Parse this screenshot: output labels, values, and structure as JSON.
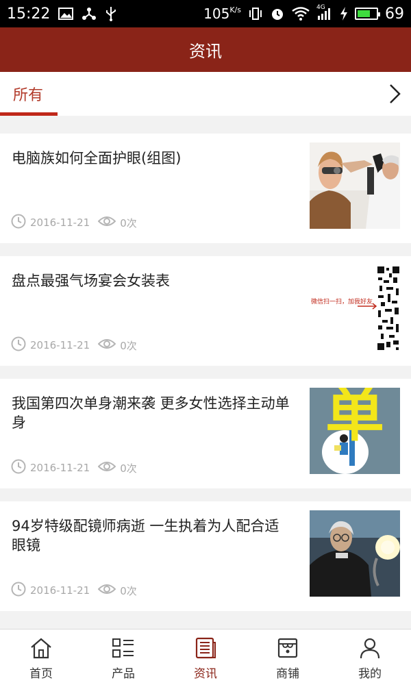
{
  "status_bar": {
    "time": "15:22",
    "speed": "105",
    "speed_unit": "K/s",
    "network": "4G",
    "battery_level": "69",
    "battery_fraction": 0.69,
    "icons": [
      "image-icon",
      "share-icon",
      "usb-icon",
      "vibrate-icon",
      "alarm-icon",
      "wifi-icon",
      "signal-icon",
      "charging-icon",
      "battery-icon"
    ]
  },
  "header": {
    "title": "资讯"
  },
  "tabs": {
    "active_label": "所有",
    "more_icon": "chevron-right-icon",
    "accent": "#c0281a"
  },
  "news": [
    {
      "title": "电脑族如何全面护眼(组图)",
      "date": "2016-11-21",
      "views": "0次",
      "thumb": "eye-exam-photo"
    },
    {
      "title": "盘点最强气场宴会女装表",
      "date": "2016-11-21",
      "views": "0次",
      "thumb": "qr-code-promo",
      "thumb_text": "微信扫一扫，加我好友"
    },
    {
      "title": "我国第四次单身潮来袭 更多女性选择主动单身",
      "date": "2016-11-21",
      "views": "0次",
      "thumb": "single-character-illustration",
      "thumb_text": "单"
    },
    {
      "title": "94岁特级配镜师病逝 一生执着为人配合适眼镜",
      "date": "2016-11-21",
      "views": "0次",
      "thumb": "elderly-optician-photo"
    }
  ],
  "bottom_nav": [
    {
      "label": "首页",
      "icon": "home-icon"
    },
    {
      "label": "产品",
      "icon": "grid-list-icon"
    },
    {
      "label": "资讯",
      "icon": "news-icon",
      "active": true
    },
    {
      "label": "商铺",
      "icon": "store-icon"
    },
    {
      "label": "我的",
      "icon": "user-icon"
    }
  ],
  "colors": {
    "brand": "#8a2418",
    "active_tab": "#c0281a",
    "meta_text": "#a8a8a8"
  }
}
